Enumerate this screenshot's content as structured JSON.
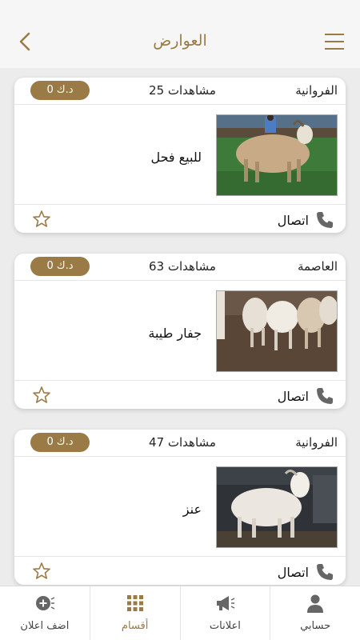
{
  "header": {
    "title": "العوارض"
  },
  "listings": [
    {
      "location": "الفروانية",
      "views": "25 مشاهدات",
      "price": "0 د.ك",
      "title": "للبيع فحل",
      "call_label": "اتصال",
      "image": "goat-on-grass"
    },
    {
      "location": "العاصمة",
      "views": "63 مشاهدات",
      "price": "0 د.ك",
      "title": "جفار طيبة",
      "call_label": "اتصال",
      "image": "goat-herd"
    },
    {
      "location": "الفروانية",
      "views": "47 مشاهدات",
      "price": "0 د.ك",
      "title": "عنز",
      "call_label": "اتصال",
      "image": "white-goat"
    }
  ],
  "tabbar": {
    "add": "اضف اعلان",
    "sections": "أقسام",
    "ads": "اعلانات",
    "account": "حسابي"
  },
  "colors": {
    "accent": "#9b7b45",
    "icon_grey": "#666666"
  }
}
